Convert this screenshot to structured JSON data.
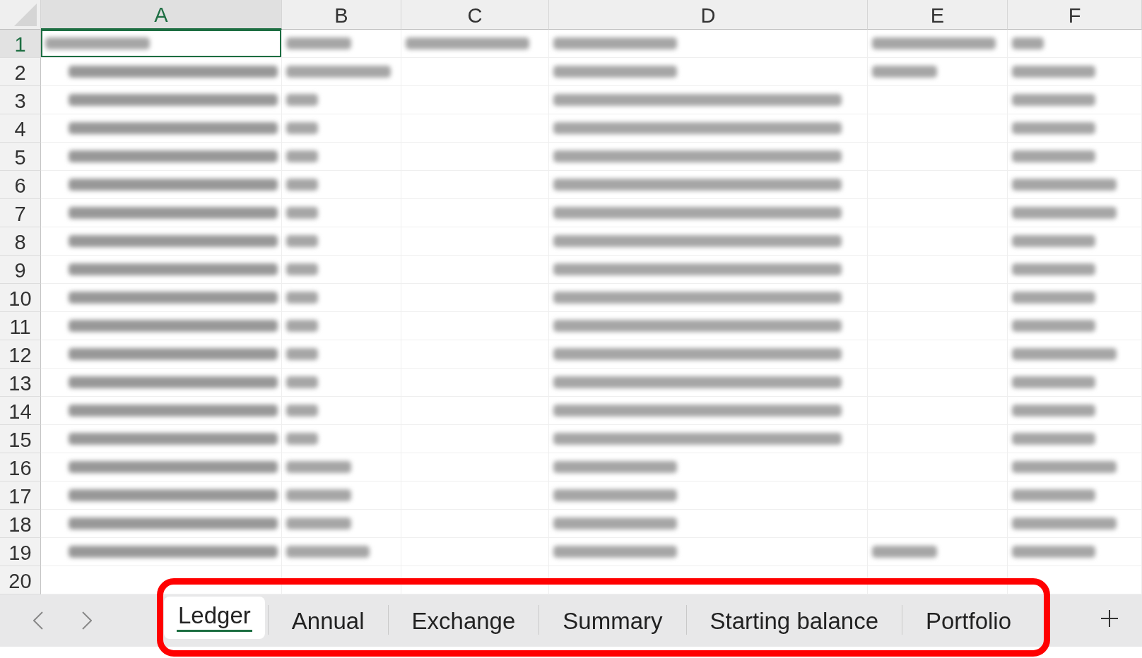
{
  "sheet": {
    "columns": [
      {
        "label": "A",
        "selected": true
      },
      {
        "label": "B",
        "selected": false
      },
      {
        "label": "C",
        "selected": false
      },
      {
        "label": "D",
        "selected": false
      },
      {
        "label": "E",
        "selected": false
      },
      {
        "label": "F",
        "selected": false
      }
    ],
    "rows": [
      {
        "number": "1",
        "selected": true,
        "cells": [
          {
            "kind": "long"
          },
          {
            "kind": "short"
          },
          {
            "kind": "wide"
          },
          {
            "kind": "wide"
          },
          {
            "kind": "wide"
          },
          {
            "kind": "tiny"
          }
        ]
      },
      {
        "number": "2",
        "selected": false,
        "cells": [
          {
            "kind": "date"
          },
          {
            "kind": "long"
          },
          {
            "kind": "blank"
          },
          {
            "kind": "wide"
          },
          {
            "kind": "short"
          },
          {
            "kind": "medium"
          }
        ]
      },
      {
        "number": "3",
        "selected": false,
        "cells": [
          {
            "kind": "date"
          },
          {
            "kind": "tiny"
          },
          {
            "kind": "blank"
          },
          {
            "kind": "phrase"
          },
          {
            "kind": "blank"
          },
          {
            "kind": "medium"
          }
        ]
      },
      {
        "number": "4",
        "selected": false,
        "cells": [
          {
            "kind": "date"
          },
          {
            "kind": "tiny"
          },
          {
            "kind": "blank"
          },
          {
            "kind": "phrase"
          },
          {
            "kind": "blank"
          },
          {
            "kind": "medium"
          }
        ]
      },
      {
        "number": "5",
        "selected": false,
        "cells": [
          {
            "kind": "date"
          },
          {
            "kind": "tiny"
          },
          {
            "kind": "blank"
          },
          {
            "kind": "phrase"
          },
          {
            "kind": "blank"
          },
          {
            "kind": "medium"
          }
        ]
      },
      {
        "number": "6",
        "selected": false,
        "cells": [
          {
            "kind": "date"
          },
          {
            "kind": "tiny"
          },
          {
            "kind": "blank"
          },
          {
            "kind": "phrase"
          },
          {
            "kind": "blank"
          },
          {
            "kind": "long"
          }
        ]
      },
      {
        "number": "7",
        "selected": false,
        "cells": [
          {
            "kind": "date"
          },
          {
            "kind": "tiny"
          },
          {
            "kind": "blank"
          },
          {
            "kind": "phrase"
          },
          {
            "kind": "blank"
          },
          {
            "kind": "long"
          }
        ]
      },
      {
        "number": "8",
        "selected": false,
        "cells": [
          {
            "kind": "date"
          },
          {
            "kind": "tiny"
          },
          {
            "kind": "blank"
          },
          {
            "kind": "phrase"
          },
          {
            "kind": "blank"
          },
          {
            "kind": "medium"
          }
        ]
      },
      {
        "number": "9",
        "selected": false,
        "cells": [
          {
            "kind": "date"
          },
          {
            "kind": "tiny"
          },
          {
            "kind": "blank"
          },
          {
            "kind": "phrase"
          },
          {
            "kind": "blank"
          },
          {
            "kind": "medium"
          }
        ]
      },
      {
        "number": "10",
        "selected": false,
        "cells": [
          {
            "kind": "date"
          },
          {
            "kind": "tiny"
          },
          {
            "kind": "blank"
          },
          {
            "kind": "phrase"
          },
          {
            "kind": "blank"
          },
          {
            "kind": "medium"
          }
        ]
      },
      {
        "number": "11",
        "selected": false,
        "cells": [
          {
            "kind": "date"
          },
          {
            "kind": "tiny"
          },
          {
            "kind": "blank"
          },
          {
            "kind": "phrase"
          },
          {
            "kind": "blank"
          },
          {
            "kind": "medium"
          }
        ]
      },
      {
        "number": "12",
        "selected": false,
        "cells": [
          {
            "kind": "date"
          },
          {
            "kind": "tiny"
          },
          {
            "kind": "blank"
          },
          {
            "kind": "phrase"
          },
          {
            "kind": "blank"
          },
          {
            "kind": "long"
          }
        ]
      },
      {
        "number": "13",
        "selected": false,
        "cells": [
          {
            "kind": "date"
          },
          {
            "kind": "tiny"
          },
          {
            "kind": "blank"
          },
          {
            "kind": "phrase"
          },
          {
            "kind": "blank"
          },
          {
            "kind": "medium"
          }
        ]
      },
      {
        "number": "14",
        "selected": false,
        "cells": [
          {
            "kind": "date"
          },
          {
            "kind": "tiny"
          },
          {
            "kind": "blank"
          },
          {
            "kind": "phrase"
          },
          {
            "kind": "blank"
          },
          {
            "kind": "medium"
          }
        ]
      },
      {
        "number": "15",
        "selected": false,
        "cells": [
          {
            "kind": "date"
          },
          {
            "kind": "tiny"
          },
          {
            "kind": "blank"
          },
          {
            "kind": "phrase"
          },
          {
            "kind": "blank"
          },
          {
            "kind": "medium"
          }
        ]
      },
      {
        "number": "16",
        "selected": false,
        "cells": [
          {
            "kind": "date"
          },
          {
            "kind": "short"
          },
          {
            "kind": "blank"
          },
          {
            "kind": "wide"
          },
          {
            "kind": "blank"
          },
          {
            "kind": "long"
          }
        ]
      },
      {
        "number": "17",
        "selected": false,
        "cells": [
          {
            "kind": "date"
          },
          {
            "kind": "short"
          },
          {
            "kind": "blank"
          },
          {
            "kind": "wide"
          },
          {
            "kind": "blank"
          },
          {
            "kind": "medium"
          }
        ]
      },
      {
        "number": "18",
        "selected": false,
        "cells": [
          {
            "kind": "date"
          },
          {
            "kind": "short"
          },
          {
            "kind": "blank"
          },
          {
            "kind": "wide"
          },
          {
            "kind": "blank"
          },
          {
            "kind": "long"
          }
        ]
      },
      {
        "number": "19",
        "selected": false,
        "cells": [
          {
            "kind": "date"
          },
          {
            "kind": "medium"
          },
          {
            "kind": "blank"
          },
          {
            "kind": "wide"
          },
          {
            "kind": "short"
          },
          {
            "kind": "medium"
          }
        ]
      },
      {
        "number": "20",
        "selected": false,
        "cells": [
          {
            "kind": "blank"
          },
          {
            "kind": "blank"
          },
          {
            "kind": "blank"
          },
          {
            "kind": "blank"
          },
          {
            "kind": "blank"
          },
          {
            "kind": "blank"
          }
        ]
      }
    ]
  },
  "sheet_tabs": {
    "highlighted": true,
    "tabs": [
      {
        "label": "Ledger",
        "selected": true
      },
      {
        "label": "Annual",
        "selected": false
      },
      {
        "label": "Exchange",
        "selected": false
      },
      {
        "label": "Summary",
        "selected": false
      },
      {
        "label": "Starting balance",
        "selected": false
      },
      {
        "label": "Portfolio",
        "selected": false
      }
    ]
  }
}
